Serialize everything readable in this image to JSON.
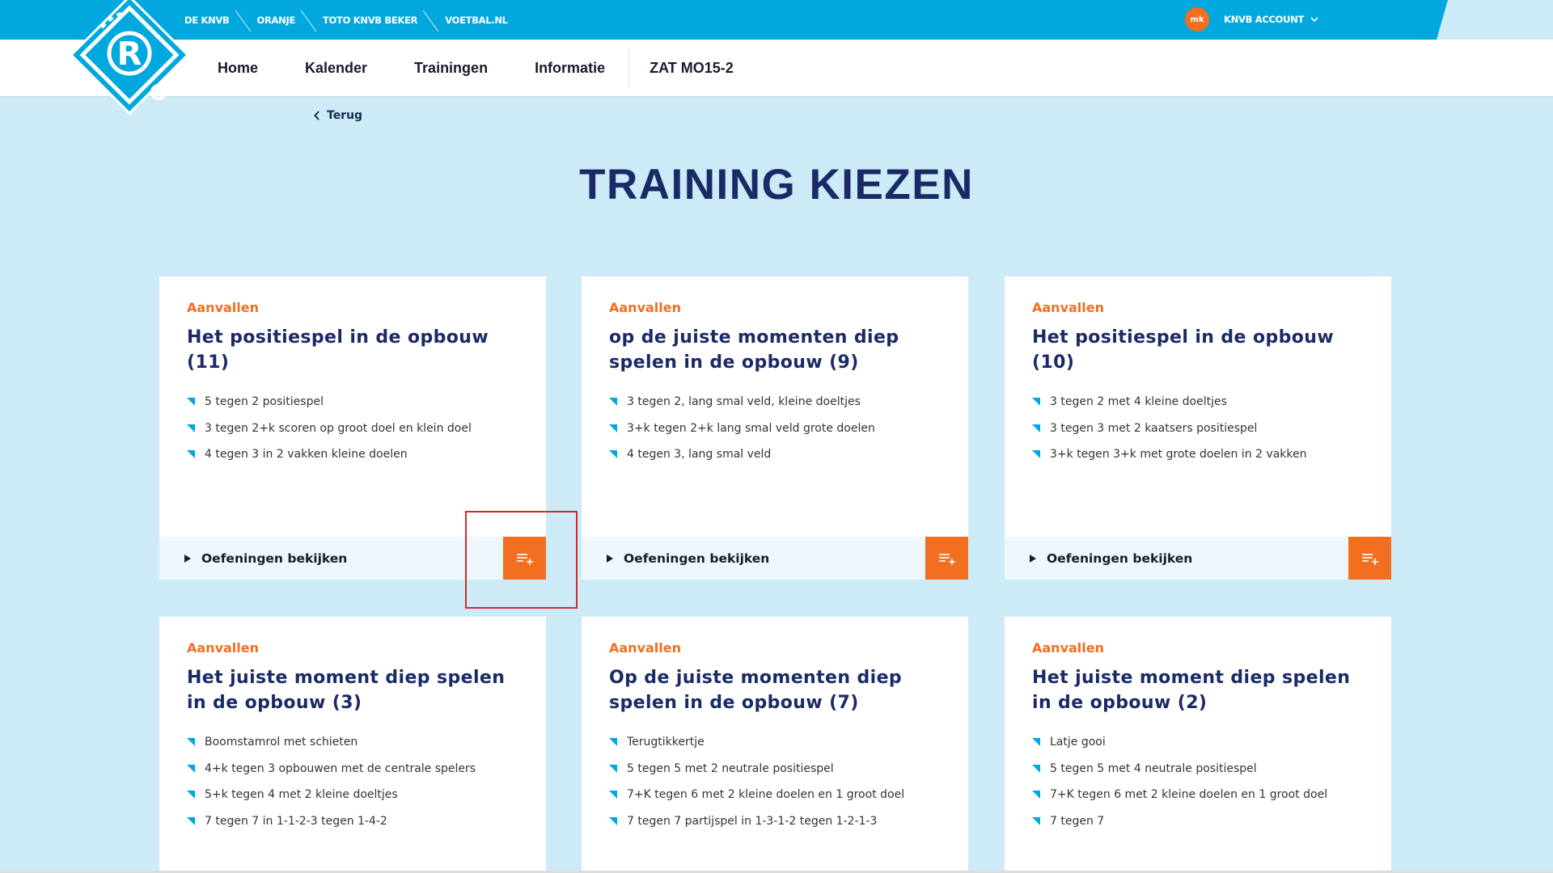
{
  "topbar": {
    "links": [
      "DE KNVB",
      "ORANJE",
      "TOTO KNVB BEKER",
      "VOETBAL.NL"
    ],
    "avatar_initials": "mk",
    "account_label": "KNVB ACCOUNT",
    "bg_color": "#00a8de"
  },
  "logo": {
    "letter": "R",
    "icon": "rinus-logo-icon"
  },
  "nav": {
    "items": [
      "Home",
      "Kalender",
      "Trainingen",
      "Informatie"
    ],
    "team": "ZAT MO15-2"
  },
  "back_label": "Terug",
  "page_title": "TRAINING KIEZEN",
  "accent_color": "#f26f21",
  "cards": [
    {
      "category": "Aanvallen",
      "title": "Het positiespel in de opbouw (11)",
      "exercises": [
        "5 tegen 2 positiespel",
        "3 tegen 2+k scoren op groot doel en klein doel",
        "4 tegen 3 in 2 vakken kleine doelen"
      ],
      "view_label": "Oefeningen bekijken"
    },
    {
      "category": "Aanvallen",
      "title": "op de juiste momenten diep spelen in de opbouw (9)",
      "exercises": [
        "3 tegen 2, lang smal veld, kleine doeltjes",
        "3+k tegen 2+k lang smal veld grote doelen",
        "4 tegen 3, lang smal veld"
      ],
      "view_label": "Oefeningen bekijken"
    },
    {
      "category": "Aanvallen",
      "title": "Het positiespel in de opbouw (10)",
      "exercises": [
        "3 tegen 2 met 4 kleine doeltjes",
        "3 tegen 3 met 2 kaatsers positiespel",
        "3+k tegen 3+k met grote doelen in 2 vakken"
      ],
      "view_label": "Oefeningen bekijken"
    },
    {
      "category": "Aanvallen",
      "title": "Het juiste moment diep spelen in de opbouw (3)",
      "exercises": [
        "Boomstamrol met schieten",
        "4+k tegen 3 opbouwen met de centrale spelers",
        "5+k tegen 4 met 2 kleine doeltjes",
        "7 tegen 7 in 1-1-2-3 tegen 1-4-2"
      ]
    },
    {
      "category": "Aanvallen",
      "title": "Op de juiste momenten diep spelen in de opbouw (7)",
      "exercises": [
        "Terugtikkertje",
        "5 tegen 5 met 2 neutrale positiespel",
        "7+K tegen 6 met 2 kleine doelen en 1 groot doel",
        "7 tegen 7 partijspel in 1-3-1-2 tegen 1-2-1-3"
      ]
    },
    {
      "category": "Aanvallen",
      "title": "Het juiste moment diep spelen in de opbouw (2)",
      "exercises": [
        "Latje gooi",
        "5 tegen 5 met 4 neutrale positiespel",
        "7+K tegen 6 met 2 kleine doelen en 1 groot doel",
        "7 tegen 7"
      ]
    }
  ]
}
